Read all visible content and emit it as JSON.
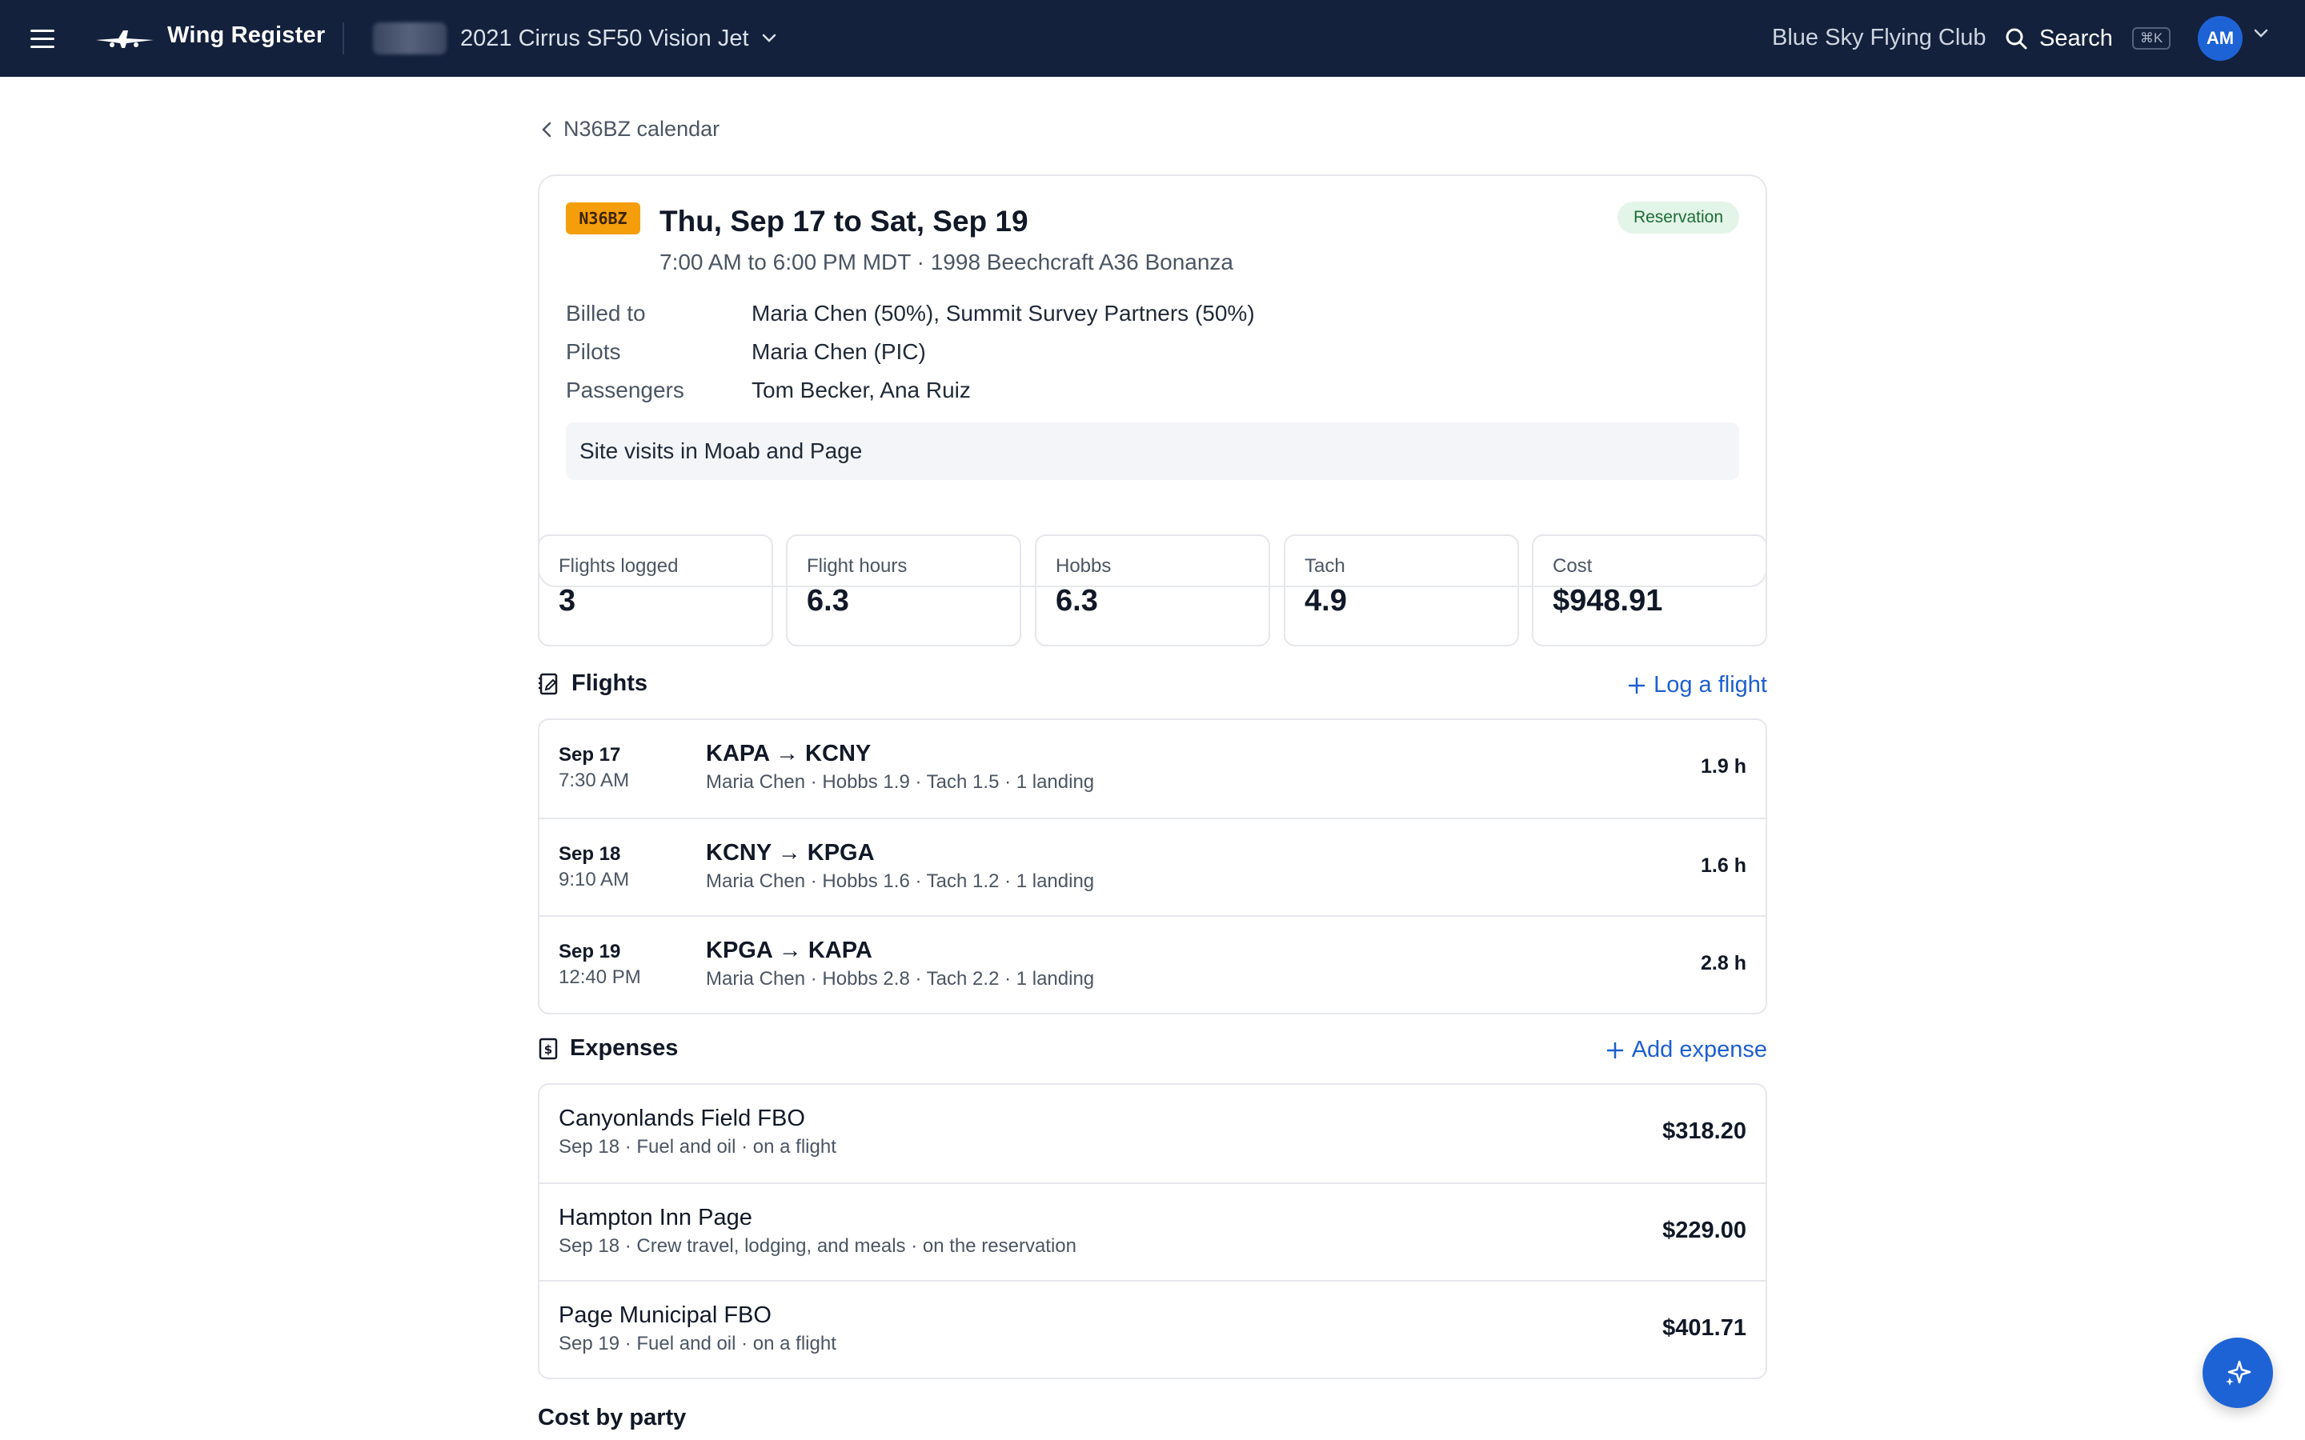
{
  "app": {
    "name": "Wing Register"
  },
  "header": {
    "aircraft_select": "2021 Cirrus SF50 Vision Jet",
    "club": "Blue Sky Flying Club",
    "search_label": "Search",
    "search_shortcut": "⌘K",
    "avatar_initials": "AM"
  },
  "breadcrumb": {
    "back_label": "N36BZ calendar"
  },
  "reservation": {
    "tail": "N36BZ",
    "title": "Thu, Sep 17 to Sat, Sep 19",
    "subtitle": "7:00 AM to 6:00 PM MDT · 1998 Beechcraft A36 Bonanza",
    "status": "Reservation",
    "billed_to_label": "Billed to",
    "billed_to": "Maria Chen (50%), Summit Survey Partners (50%)",
    "pilots_label": "Pilots",
    "pilots": "Maria Chen (PIC)",
    "passengers_label": "Passengers",
    "passengers": "Tom Becker, Ana Ruiz",
    "note": "Site visits in Moab and Page"
  },
  "stats": [
    {
      "label": "Flights logged",
      "value": "3"
    },
    {
      "label": "Flight hours",
      "value": "6.3"
    },
    {
      "label": "Hobbs",
      "value": "6.3"
    },
    {
      "label": "Tach",
      "value": "4.9"
    },
    {
      "label": "Cost",
      "value": "$948.91"
    }
  ],
  "flights": {
    "title": "Flights",
    "action": "Log a flight",
    "rows": [
      {
        "date": "Sep 17",
        "time": "7:30 AM",
        "route": "KAPA → KCNY",
        "detail": "Maria Chen · Hobbs 1.9 · Tach 1.5 · 1 landing",
        "hours": "1.9 h"
      },
      {
        "date": "Sep 18",
        "time": "9:10 AM",
        "route": "KCNY → KPGA",
        "detail": "Maria Chen · Hobbs 1.6 · Tach 1.2 · 1 landing",
        "hours": "1.6 h"
      },
      {
        "date": "Sep 19",
        "time": "12:40 PM",
        "route": "KPGA → KAPA",
        "detail": "Maria Chen · Hobbs 2.8 · Tach 2.2 · 1 landing",
        "hours": "2.8 h"
      }
    ]
  },
  "expenses": {
    "title": "Expenses",
    "action": "Add expense",
    "rows": [
      {
        "name": "Canyonlands Field FBO",
        "detail": "Sep 18 · Fuel and oil · on a flight",
        "amount": "$318.20"
      },
      {
        "name": "Hampton Inn Page",
        "detail": "Sep 18 · Crew travel, lodging, and meals · on the reservation",
        "amount": "$229.00"
      },
      {
        "name": "Page Municipal FBO",
        "detail": "Sep 19 · Fuel and oil · on a flight",
        "amount": "$401.71"
      }
    ]
  },
  "cost_by_party": {
    "title": "Cost by party"
  }
}
